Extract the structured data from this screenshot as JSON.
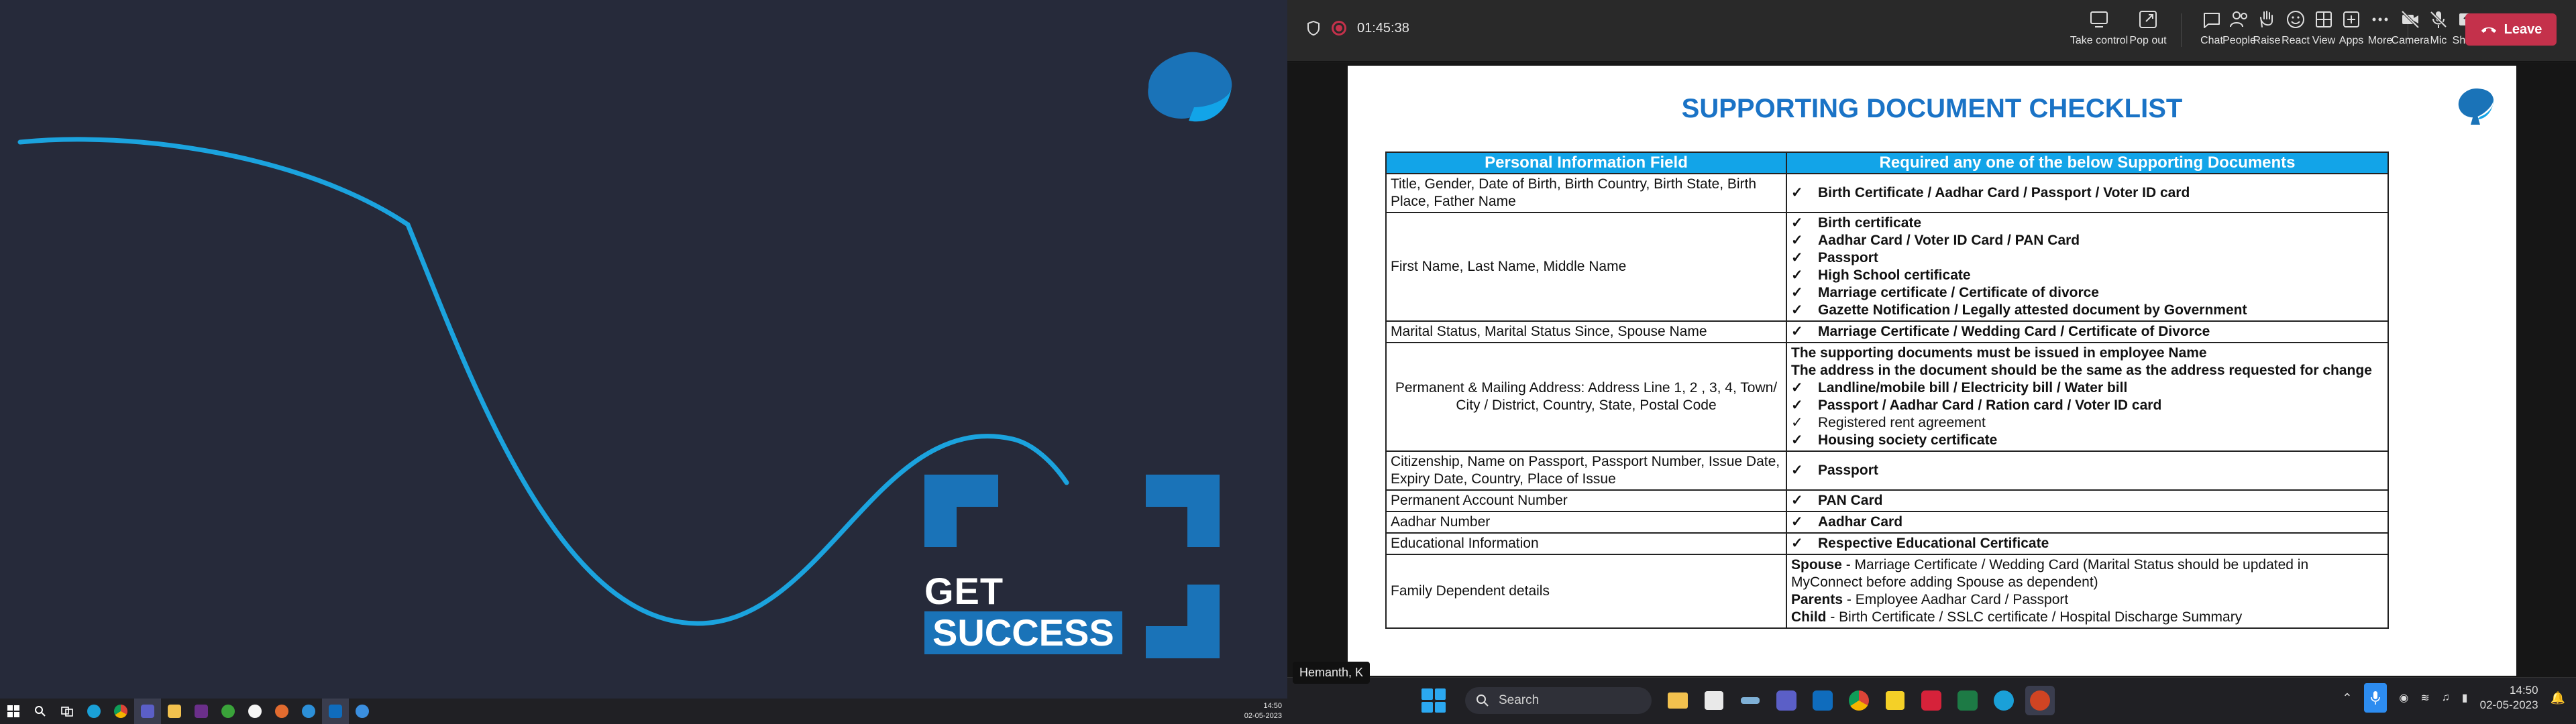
{
  "left_desktop": {
    "wallpaper": {
      "line1": "GET",
      "line2": "SUCCESS",
      "accent": "#1a73b8",
      "curve_color": "#1ba3de",
      "background": "#262a3a"
    },
    "taskbar": {
      "icons": [
        "windows-icon",
        "search-icon",
        "task-view-icon",
        "edge-icon",
        "chrome-icon",
        "teams-icon",
        "file-explorer-icon",
        "app-icon",
        "app-icon",
        "app-icon",
        "app-icon",
        "app-icon",
        "outlook-icon",
        "app-icon"
      ],
      "clock_time": "14:50",
      "clock_date": "02-05-2023"
    }
  },
  "teams": {
    "timer": "01:45:38",
    "toolbar": [
      {
        "label": "Take control",
        "icon": "take-control-icon"
      },
      {
        "label": "Pop out",
        "icon": "pop-out-icon"
      },
      {
        "label": "Chat",
        "icon": "chat-icon"
      },
      {
        "label": "People",
        "icon": "people-icon"
      },
      {
        "label": "Raise",
        "icon": "raise-hand-icon"
      },
      {
        "label": "React",
        "icon": "react-icon"
      },
      {
        "label": "View",
        "icon": "view-icon"
      },
      {
        "label": "Apps",
        "icon": "apps-icon"
      },
      {
        "label": "More",
        "icon": "more-icon"
      },
      {
        "label": "Camera",
        "icon": "camera-off-icon"
      },
      {
        "label": "Mic",
        "icon": "mic-off-icon"
      },
      {
        "label": "Share",
        "icon": "share-icon"
      }
    ],
    "leave_label": "Leave",
    "presenter_name": "Hemanth, K"
  },
  "slide": {
    "title": "SUPPORTING DOCUMENT CHECKLIST",
    "header_field": "Personal Information Field",
    "header_docs": "Required any one of the below Supporting Documents",
    "rows": {
      "r1": {
        "field": "Title, Gender, Date of Birth, Birth Country, Birth State, Birth Place, Father Name",
        "d1": "Birth Certificate / Aadhar Card / Passport / Voter ID card"
      },
      "r2": {
        "field": "First Name, Last Name, Middle Name",
        "d1": "Birth certificate",
        "d2": "Aadhar Card / Voter ID Card / PAN Card",
        "d3": "Passport",
        "d4": "High School certificate",
        "d5": "Marriage certificate / Certificate of divorce",
        "d6": "Gazette Notification / Legally attested document by Government"
      },
      "r3": {
        "field": "Marital Status, Marital Status Since, Spouse Name",
        "d1": "Marriage Certificate / Wedding Card / Certificate of Divorce"
      },
      "r4": {
        "field": "Permanent  & Mailing Address: Address Line 1, 2 , 3, 4, Town/ City / District, Country, State, Postal Code",
        "note1": "The supporting documents must be issued in employee Name",
        "note2": "The address in the document should be the same as the address requested for change",
        "d1": "Landline/mobile bill / Electricity bill / Water bill",
        "d2": "Passport / Aadhar Card / Ration card / Voter ID card",
        "d3": "Registered rent agreement",
        "d4": "Housing society certificate"
      },
      "r5": {
        "field": "Citizenship, Name on Passport, Passport Number, Issue Date, Expiry Date, Country, Place of Issue",
        "d1": "Passport"
      },
      "r6": {
        "field": "Permanent Account Number",
        "d1": "PAN Card"
      },
      "r7": {
        "field": "Aadhar Number",
        "d1": "Aadhar Card"
      },
      "r8": {
        "field": "Educational Information",
        "d1": "Respective Educational Certificate"
      },
      "r9": {
        "field": "Family Dependent details",
        "spouse_label": "Spouse",
        "spouse_text": " - Marriage Certificate / Wedding Card (Marital Status should be updated in MyConnect before adding Spouse as dependent)",
        "parents_label": "Parents",
        "parents_text": " - Employee Aadhar Card / Passport",
        "child_label": "Child",
        "child_text": " -  Birth Certificate / SSLC certificate / Hospital Discharge Summary"
      }
    },
    "tick": "✓",
    "header_color": "#12a4e8",
    "title_color": "#1a73c6"
  },
  "right_taskbar": {
    "search_placeholder": "Search",
    "clock_time": "14:50",
    "clock_date": "02-05-2023"
  }
}
